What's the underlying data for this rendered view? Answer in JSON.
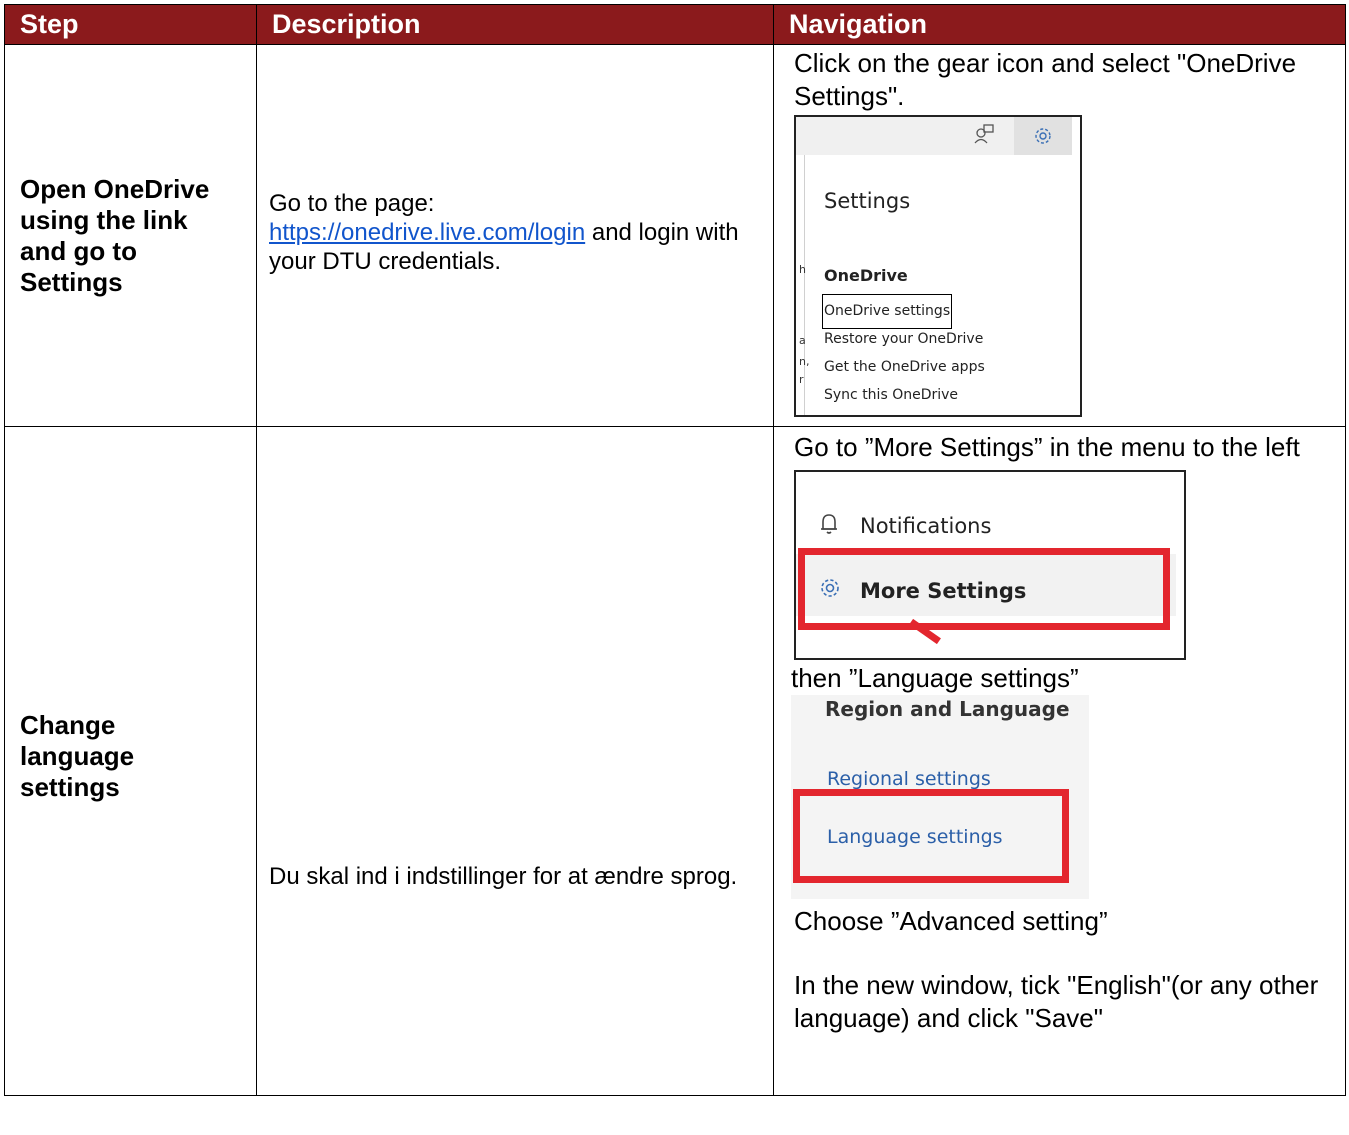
{
  "table": {
    "headers": [
      "Step",
      "Description",
      "Navigation"
    ],
    "rows": [
      {
        "step": "Open OneDrive using the link and go to Settings",
        "description": {
          "prefix": "Go to the page:",
          "link": "https://onedrive.live.com/login",
          "suffix": " and login with your DTU credentials."
        },
        "navigation": {
          "text1": "Click on the gear icon and select \"OneDrive Settings\".",
          "screenshot": {
            "title": "Settings",
            "section": "OneDrive",
            "items": [
              "OneDrive settings",
              "Restore your OneDrive",
              "Get the OneDrive apps",
              "Sync this OneDrive"
            ],
            "highlighted_item": "OneDrive settings",
            "icons": [
              "people-icon",
              "gear-icon"
            ]
          }
        }
      },
      {
        "step": "Change language settings",
        "description": "Du skal ind i indstillinger for at ændre sprog.",
        "navigation": {
          "text1": "Go to ”More Settings” in the menu to the left",
          "screenshot_menu": {
            "item1": "Notifications",
            "item2": "More Settings",
            "highlight_color": "#e3262e"
          },
          "text2": "then ”Language settings”",
          "screenshot_region": {
            "title": "Region and Language",
            "item1": "Regional settings",
            "item2": "Language settings"
          },
          "text3": "Choose ”Advanced setting”",
          "text4": "In the new window, tick \"English\"(or any other language) and click \"Save\""
        }
      }
    ]
  },
  "colors": {
    "header_bg": "#8b1a1c",
    "link": "#1155cc",
    "highlight": "#e3262e"
  }
}
